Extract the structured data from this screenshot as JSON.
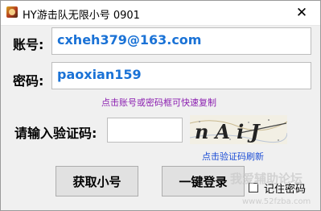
{
  "window": {
    "title": "HY游击队无限小号 0901",
    "close_glyph": "✕"
  },
  "account": {
    "label": "账号:",
    "value": "cxheh379@163.com"
  },
  "password": {
    "label": "密码:",
    "value": "paoxian159"
  },
  "copy_hint": "点击账号或密码框可快速复制",
  "captcha": {
    "label": "请输入验证码:",
    "input_value": "",
    "image_text": "nAiJ",
    "refresh_hint": "点击验证码刷新"
  },
  "buttons": {
    "get_account": "获取小号",
    "one_click_login": "一键登录"
  },
  "checkbox": {
    "label": "记住密码",
    "checked": false
  },
  "watermark": {
    "main": "我爱辅助论坛",
    "url": "www.52fzba.com"
  },
  "colors": {
    "value_text": "#1a72d6",
    "copy_hint": "#8b1fb0",
    "refresh_hint": "#1e4fd6"
  }
}
